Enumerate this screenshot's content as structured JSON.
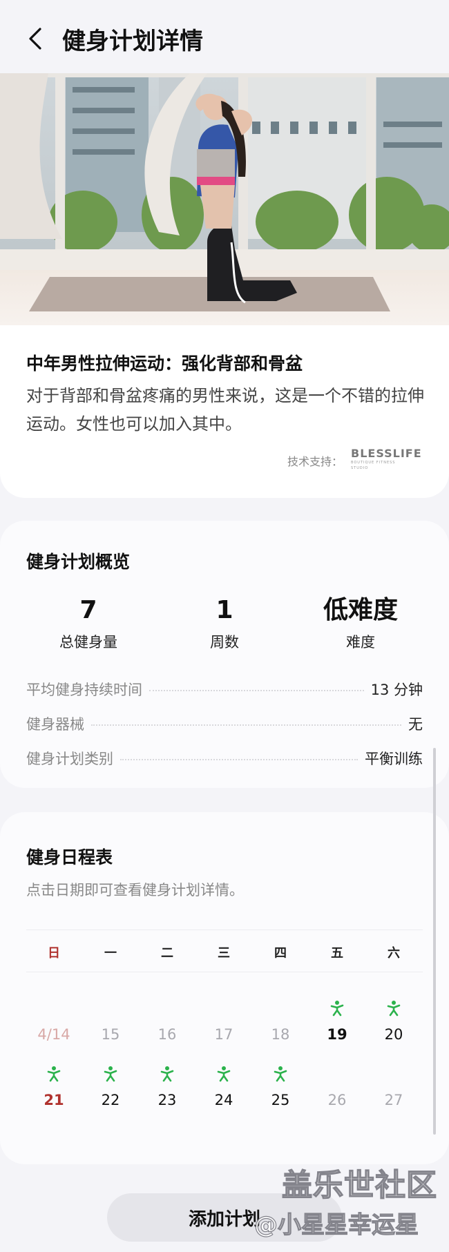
{
  "header": {
    "title": "健身计划详情"
  },
  "intro": {
    "title": "中年男性拉伸运动：强化背部和骨盆",
    "description": "对于背部和骨盆疼痛的男性来说，这是一个不错的拉伸运动。女性也可以加入其中。",
    "tech_support_label": "技术支持：",
    "partner_logo": "BLESSLIFE",
    "partner_sub": "BOUTIQUE FITNESS STUDIO"
  },
  "overview": {
    "title": "健身计划概览",
    "stats": [
      {
        "value": "7",
        "label": "总健身量"
      },
      {
        "value": "1",
        "label": "周数"
      },
      {
        "value": "低难度",
        "label": "难度"
      }
    ],
    "details": [
      {
        "label": "平均健身持续时间",
        "value": "13 分钟"
      },
      {
        "label": "健身器械",
        "value": "无"
      },
      {
        "label": "健身计划类别",
        "value": "平衡训练"
      }
    ]
  },
  "schedule": {
    "title": "健身日程表",
    "hint": "点击日期即可查看健身计划详情。",
    "weekdays": [
      "日",
      "一",
      "二",
      "三",
      "四",
      "五",
      "六"
    ],
    "week1": [
      {
        "day": "4/14",
        "workout": false
      },
      {
        "day": "15",
        "workout": false
      },
      {
        "day": "16",
        "workout": false
      },
      {
        "day": "17",
        "workout": false
      },
      {
        "day": "18",
        "workout": false
      },
      {
        "day": "19",
        "workout": true
      },
      {
        "day": "20",
        "workout": true
      }
    ],
    "week2": [
      {
        "day": "21",
        "workout": true
      },
      {
        "day": "22",
        "workout": true
      },
      {
        "day": "23",
        "workout": true
      },
      {
        "day": "24",
        "workout": true
      },
      {
        "day": "25",
        "workout": true
      },
      {
        "day": "26",
        "workout": false
      },
      {
        "day": "27",
        "workout": false
      }
    ],
    "colors": {
      "sunday": "#b0322e",
      "today": "#b0322e",
      "workout_icon": "#2bb24c",
      "inactive": "#a8a8ae",
      "past": "#d8a8a6"
    }
  },
  "footer": {
    "add_plan_label": "添加计划"
  },
  "watermark": {
    "line1": "盖乐世社区",
    "line2": "@小星星幸运星"
  },
  "icons": {
    "back": "chevron-left-icon",
    "workout": "person-exercise-icon"
  }
}
